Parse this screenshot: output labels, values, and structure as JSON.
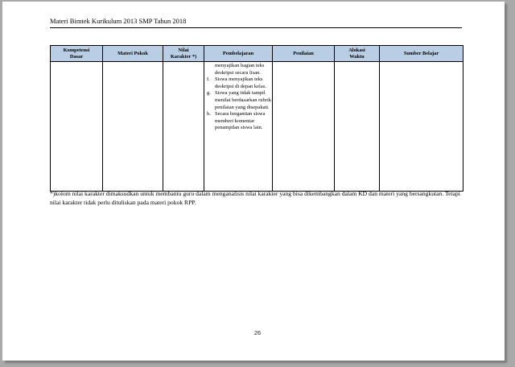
{
  "header": {
    "title": "Materi Bimtek Kurikulum 2013 SMP Tahun 2018"
  },
  "table": {
    "columns": [
      "Kompetensi\nDasar",
      "Materi Pokok",
      "Nilai\nKarakter *)",
      "Pembelajaran",
      "Penilaian",
      "Alokasi\nWaktu",
      "Sumber Belajar"
    ],
    "pembelajaran_items": [
      {
        "mark": "",
        "text": "menyajikan bagian teks deskripsi secara lisan."
      },
      {
        "mark": "f.",
        "text": "Siswa menyajikan teks deskripsi di depan kelas."
      },
      {
        "mark": "g.",
        "text": "Siswa yang tidak tampil menilai berdasarkan rubrik penilaian yang disepakati."
      },
      {
        "mark": "h.",
        "text": "Secara bergantian siswa memberi komentar penampilan siswa lain."
      }
    ]
  },
  "footnote": "*)kolom nilai karakter dimaksudkan  untuk membantu guru dalam menganalisis nilai karakter yang bisa dikembangkan  dalam KD dan materi yang bersangkutan. Tetapi nilai karakter tidak perlu dituliskan pada materi pokok RPP.",
  "page_number": "26"
}
